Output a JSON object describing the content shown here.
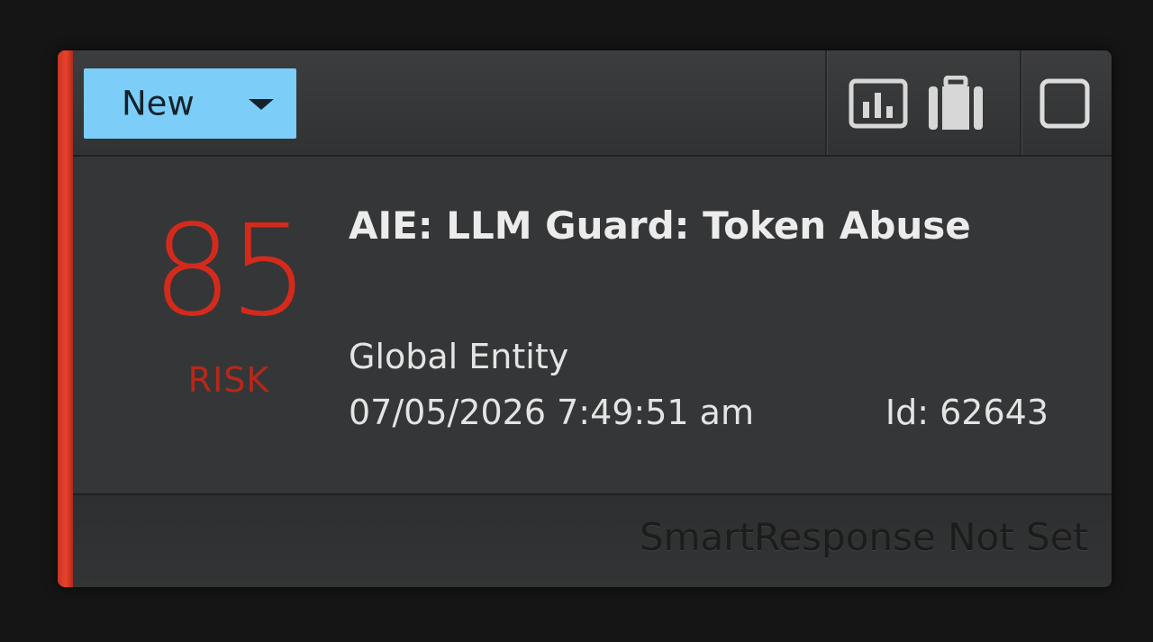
{
  "card": {
    "status": {
      "label": "New",
      "icon": "chevron-down-icon"
    },
    "toolbar": {
      "icons": [
        "bar-chart-icon",
        "briefcase-icon",
        "checkbox-icon"
      ]
    },
    "risk": {
      "score": "85",
      "label": "RISK"
    },
    "alarm": {
      "title": "AIE: LLM Guard: Token Abuse",
      "entity": "Global Entity",
      "datetime": "07/05/2026 7:49:51 am",
      "id": "Id: 62643"
    },
    "footer": {
      "smart_response": "SmartResponse Not Set"
    }
  },
  "colors": {
    "accent": "#e8432d",
    "status_button": "#7ccdf8",
    "risk": "#d42a1c",
    "card_bg": "#353637"
  }
}
